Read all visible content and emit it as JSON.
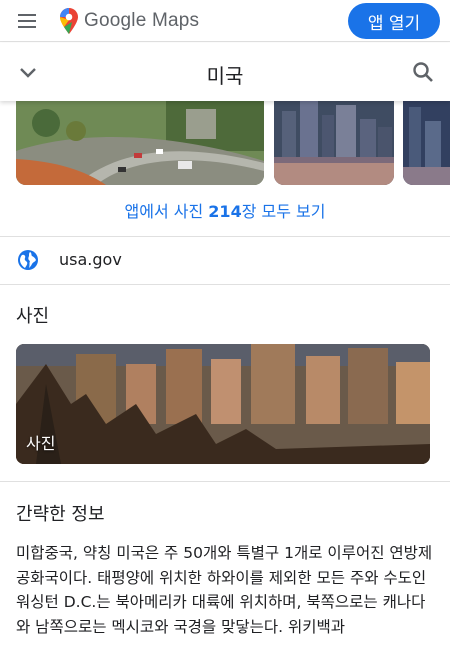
{
  "header": {
    "logo_text": "Google Maps",
    "open_app_label": "앱 열기"
  },
  "searchbar": {
    "title": "미국"
  },
  "photos_strip": {
    "see_all_prefix": "앱에서 사진 ",
    "see_all_count": "214",
    "see_all_suffix": "장 모두 보기"
  },
  "website": {
    "text": "usa.gov"
  },
  "photos_section": {
    "title": "사진",
    "card_label": "사진"
  },
  "summary": {
    "title": "간략한 정보",
    "text": "미합중국, 약칭 미국은 주 50개와 특별구 1개로 이루어진 연방제 공화국이다. 태평양에 위치한 하와이를 제외한 모든 주와 수도인 워싱턴 D.C.는 북아메리카 대륙에 위치하며, 북쪽으로는 캐나다와 남쪽으로는 멕시코와 국경을 맞닿는다. 위키백과"
  },
  "colors": {
    "accent": "#1a73e8",
    "text": "#202124",
    "icon_gray": "#5f6368"
  },
  "icons": [
    "menu-icon",
    "google-maps-pin-icon",
    "chevron-down-icon",
    "search-icon",
    "globe-icon"
  ]
}
